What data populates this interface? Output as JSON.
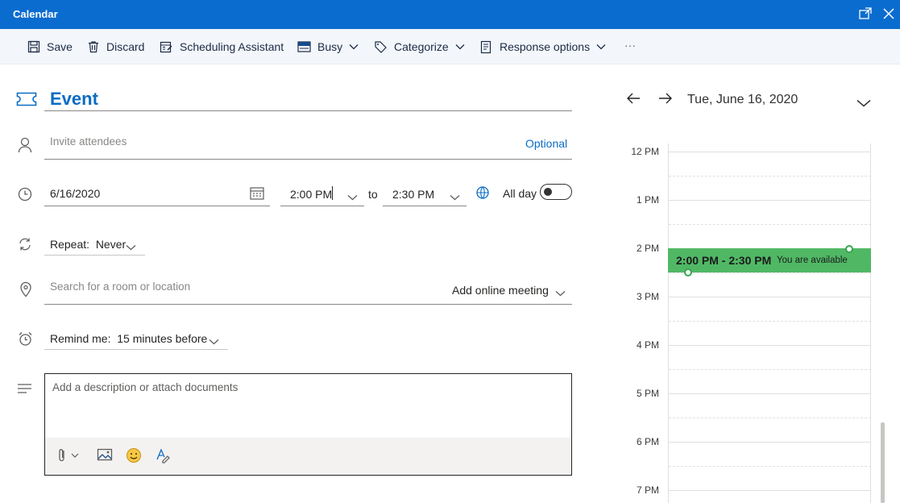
{
  "window": {
    "title": "Calendar"
  },
  "toolbar": {
    "save": "Save",
    "discard": "Discard",
    "scheduling": "Scheduling Assistant",
    "busy": "Busy",
    "categorize": "Categorize",
    "response": "Response options",
    "more": "···"
  },
  "form": {
    "title": "Event",
    "attendees_placeholder": "Invite attendees",
    "optional": "Optional",
    "date": "6/16/2020",
    "start_time": "2:00 PM",
    "to": "to",
    "end_time": "2:30 PM",
    "allday": "All day",
    "allday_on": false,
    "repeat": "Repeat:  Never",
    "location_placeholder": "Search for a room or location",
    "online_meeting": "Add online meeting",
    "remind": "Remind me:  15 minutes before",
    "description_placeholder": "Add a description or attach documents"
  },
  "side": {
    "date": "Tue, June 16, 2020",
    "hours": [
      "12 PM",
      "1 PM",
      "2 PM",
      "3 PM",
      "4 PM",
      "5 PM",
      "6 PM",
      "7 PM"
    ],
    "event_time": "2:00 PM - 2:30 PM",
    "event_status": "You are available"
  },
  "colors": {
    "titlebar": "#0b6ccf",
    "accent": "#0a6cc4",
    "event": "#50b865"
  }
}
